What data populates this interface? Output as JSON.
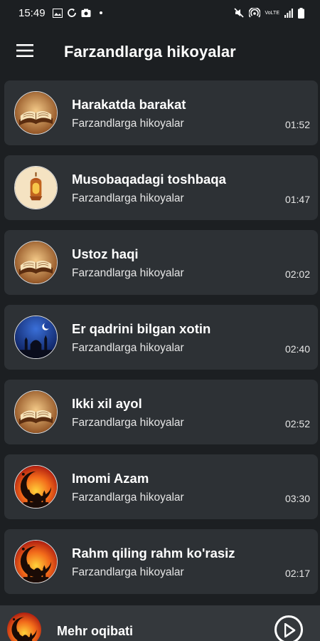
{
  "status_bar": {
    "time": "15:49",
    "left_icons": [
      "image-icon",
      "sync-icon",
      "camera-icon",
      "notification-dot"
    ],
    "right_icons": [
      "mute-icon",
      "hotspot-icon",
      "volte-icon",
      "signal-icon",
      "battery-icon"
    ],
    "network_label": "VoLTE"
  },
  "app_bar": {
    "title": "Farzandlarga hikoyalar",
    "menu_icon": "menu-icon"
  },
  "items": [
    {
      "title": "Harakatda barakat",
      "subtitle": "Farzandlarga hikoyalar",
      "duration": "01:52",
      "art": "book"
    },
    {
      "title": "Musobaqadagi toshbaqa",
      "subtitle": "Farzandlarga hikoyalar",
      "duration": "01:47",
      "art": "lantern"
    },
    {
      "title": "Ustoz haqi",
      "subtitle": "Farzandlarga hikoyalar",
      "duration": "02:02",
      "art": "book"
    },
    {
      "title": "Er qadrini bilgan xotin",
      "subtitle": "Farzandlarga hikoyalar",
      "duration": "02:40",
      "art": "night-mosque"
    },
    {
      "title": "Ikki xil ayol",
      "subtitle": "Farzandlarga hikoyalar",
      "duration": "02:52",
      "art": "book"
    },
    {
      "title": "Imomi Azam",
      "subtitle": "Farzandlarga hikoyalar",
      "duration": "03:30",
      "art": "sunset-mosque"
    },
    {
      "title": "Rahm qiling rahm ko'rasiz",
      "subtitle": "Farzandlarga hikoyalar",
      "duration": "02:17",
      "art": "sunset-mosque"
    }
  ],
  "player": {
    "title": "Mehr oqibati",
    "art": "sunset-mosque",
    "play_icon": "play-icon"
  },
  "colors": {
    "background": "#1c1f22",
    "card": "#2d3135",
    "player_bar": "#34383c",
    "text": "#ffffff"
  }
}
